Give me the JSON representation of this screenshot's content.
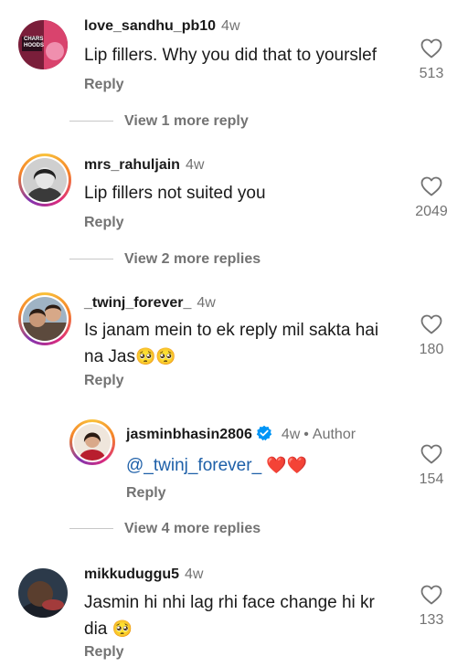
{
  "comments": [
    {
      "username": "love_sandhu_pb10",
      "time": "4w",
      "text": "Lip fillers. Why you did that to yourslef",
      "reply_label": "Reply",
      "likes": "513",
      "view_more": "View 1 more reply",
      "avatar_text": "CHARS HOODS"
    },
    {
      "username": "mrs_rahuljain",
      "time": "4w",
      "text": "Lip fillers not suited you",
      "reply_label": "Reply",
      "likes": "2049",
      "view_more": "View 2 more replies"
    },
    {
      "username": "_twinj_forever_",
      "time": "4w",
      "text_line1": "Is janam mein to ek reply mil sakta hai",
      "text_line2": "na Jas",
      "text_emoji": "🥺🥺",
      "reply_label": "Reply",
      "likes": "180",
      "view_more": "View 4 more replies"
    },
    {
      "username": "mikkuduggu5",
      "time": "4w",
      "text_line1": "Jasmin hi nhi lag rhi face change hi kr",
      "text_line2": "dia",
      "text_emoji": "🥺",
      "reply_label": "Reply",
      "likes": "133"
    }
  ],
  "author_reply": {
    "username": "jasminbhasin2806",
    "time": "4w",
    "separator": "•",
    "author_label": "Author",
    "mention": "@_twinj_forever_",
    "text_emoji": "❤️❤️",
    "reply_label": "Reply",
    "likes": "154"
  },
  "colors": {
    "mention": "#1d5fa8",
    "muted": "#737373",
    "verified": "#0095f6"
  },
  "icons": {
    "like": "heart-outline-icon",
    "verified": "verified-badge-icon"
  }
}
